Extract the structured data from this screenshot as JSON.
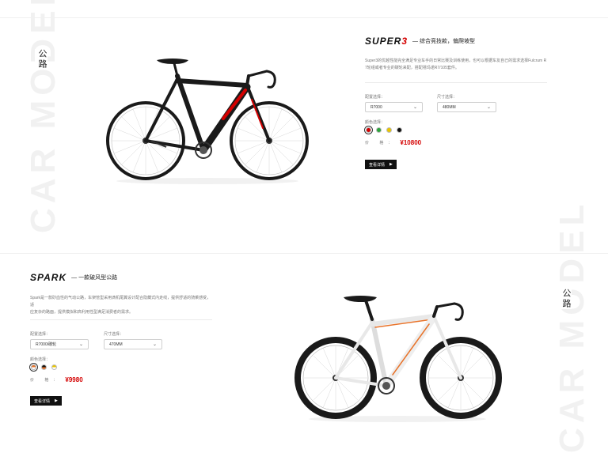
{
  "section1": {
    "watermark": "CAR MODEL",
    "category": "公路",
    "logo_main": "SUPER",
    "logo_accent": "3",
    "tagline": "— 综合竞技款，偏爬坡型",
    "description_line1": "Super3的优越性能完全满足专业车手的日常比赛及训练使用，也可以根据车友自己的需求选择Fulcrum  R",
    "description_line2": "7轮组或者专业的碳轮来配，搭配禧玛诺R7/105套件。",
    "config_label": "配置选择：",
    "config_value": "R7000",
    "size_label": "尺寸选择：",
    "size_value": "480MM",
    "color_label": "颜色选择：",
    "colors": [
      "#d40000",
      "#2aa33a",
      "#e8c400",
      "#111111"
    ],
    "price_label": "价 格：",
    "price": "¥10800",
    "button_label": "查看详情"
  },
  "section2": {
    "watermark": "CAR MODEL",
    "category": "公路",
    "logo": "SPARK",
    "tagline": "— 一款破风型公路",
    "description_line1": "Spark是一款砂血性的气动公路，车架管型采用滴机尾翼设计配合隐藏式内走线，提供舒适的骑乘感受，适",
    "description_line2": "应复杂的路面，提供模拟和高利用性型满足消费者的需求。",
    "config_label": "配置选择：",
    "config_value": "R7000/碳轮",
    "size_label": "尺寸选择：",
    "size_value": "470MM",
    "color_label": "颜色选择：",
    "colors": [
      "#e8732a",
      "#111111",
      "#e8c400"
    ],
    "price_label": "价 格：",
    "price": "¥9980",
    "button_label": "查看详情"
  }
}
